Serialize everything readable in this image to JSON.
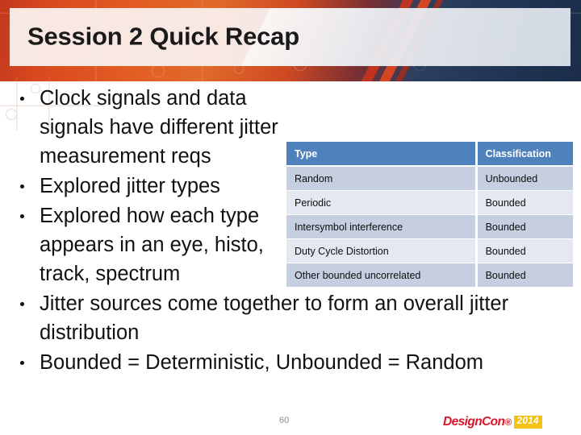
{
  "slide": {
    "title": "Session 2 Quick Recap",
    "bullets": [
      {
        "text": "Clock signals and data signals have different jitter measurement reqs",
        "width": "narrow"
      },
      {
        "text": "Explored jitter types",
        "width": "narrow"
      },
      {
        "text": "Explored how each type appears in an eye, histo, track, spectrum",
        "width": "narrow"
      },
      {
        "text": "Jitter sources come together to form an overall jitter distribution",
        "width": "wide"
      },
      {
        "text": "Bounded = Deterministic, Unbounded = Random",
        "width": "wide"
      }
    ]
  },
  "table": {
    "headers": [
      "Type",
      "Classification"
    ],
    "rows": [
      [
        "Random",
        "Unbounded"
      ],
      [
        "Periodic",
        "Bounded"
      ],
      [
        "Intersymbol interference",
        "Bounded"
      ],
      [
        "Duty Cycle Distortion",
        "Bounded"
      ],
      [
        "Other bounded uncorrelated",
        "Bounded"
      ]
    ]
  },
  "footer": {
    "slide_number": "60",
    "logo_design": "Design",
    "logo_con": "Con",
    "logo_trademark": "®",
    "logo_year": "2014"
  },
  "colors": {
    "header_orange": "#e25d23",
    "header_navy": "#1f3352",
    "table_header_blue": "#4f81bd",
    "table_row_dark": "#c6cfe1",
    "table_row_light": "#e3e8f1",
    "logo_red": "#d7182a",
    "logo_yellow": "#f2c314"
  }
}
